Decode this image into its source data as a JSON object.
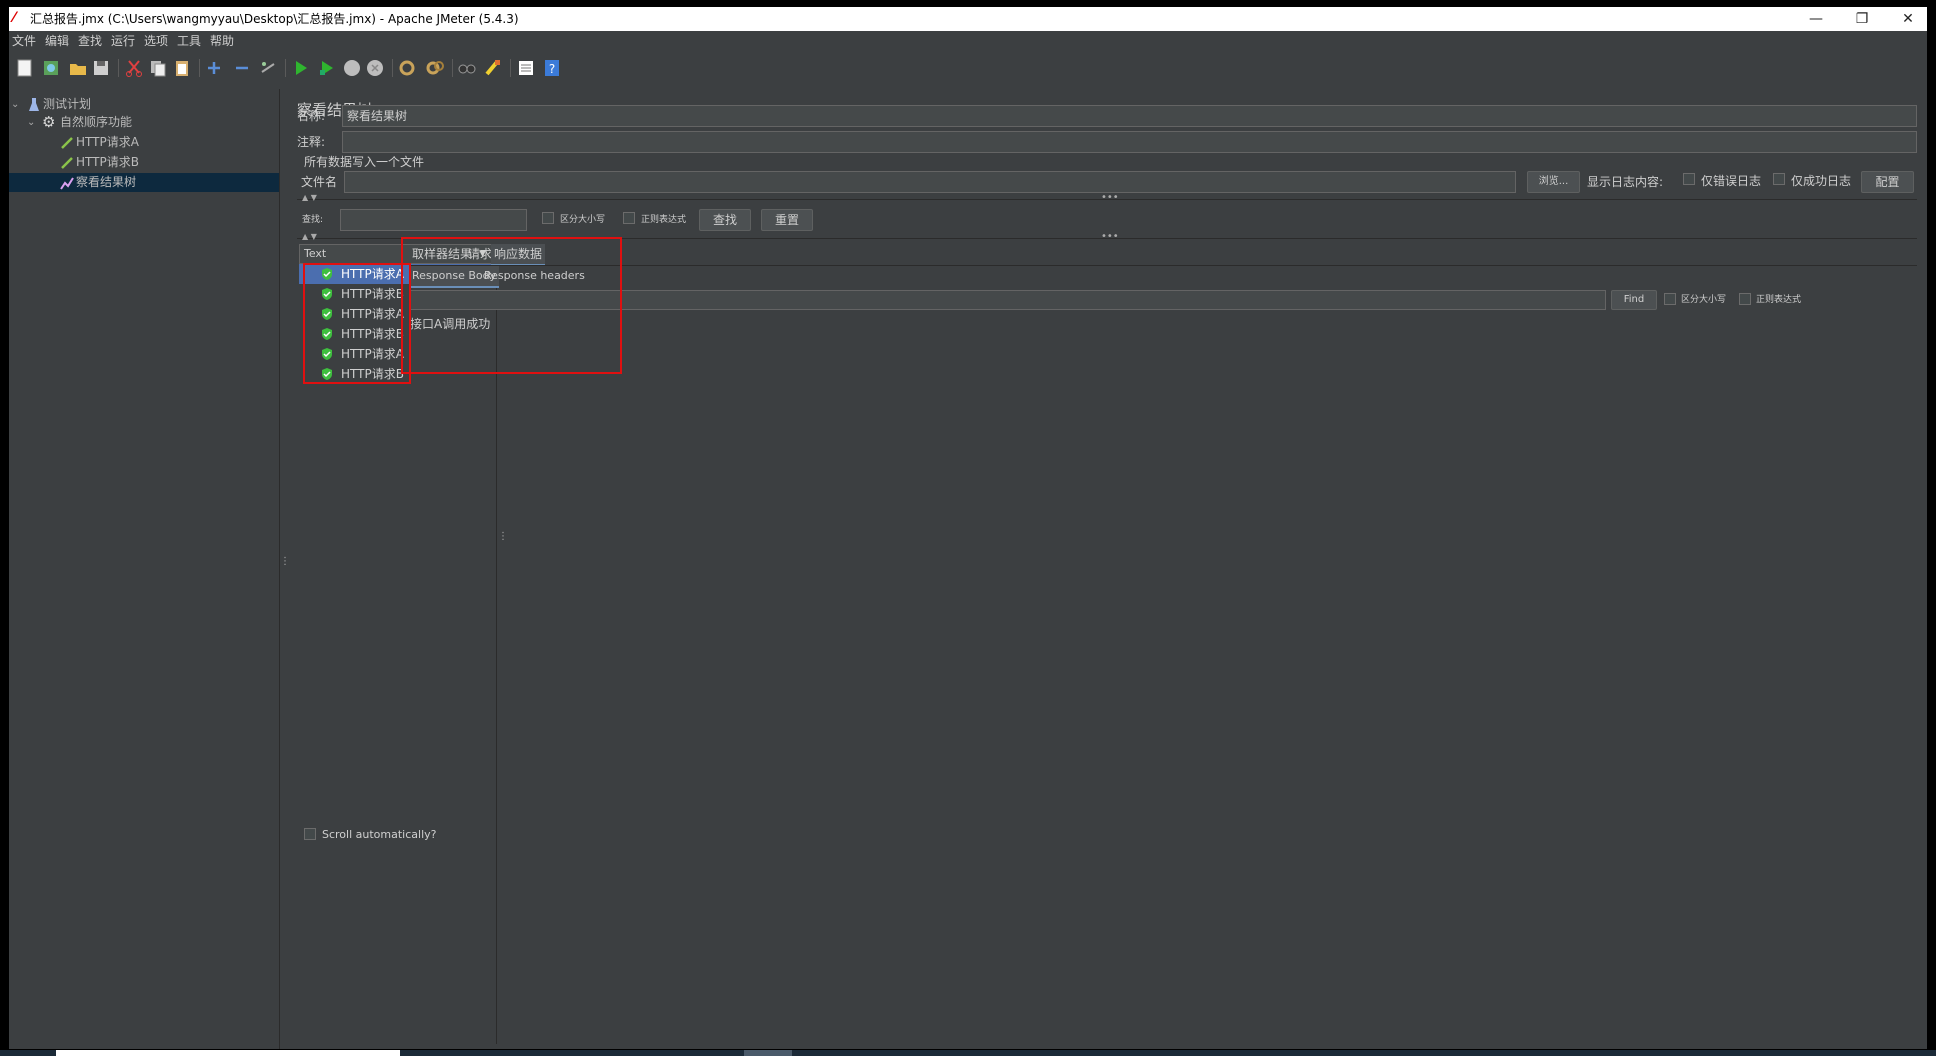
{
  "window": {
    "title": "汇总报告.jmx (C:\\Users\\wangmyyau\\Desktop\\汇总报告.jmx) - Apache JMeter (5.4.3)",
    "controls": {
      "minimize": "—",
      "restore": "❐",
      "close": "✕"
    }
  },
  "menu": [
    "文件",
    "编辑",
    "查找",
    "运行",
    "选项",
    "工具",
    "帮助"
  ],
  "toolbar": {
    "icons": [
      "new-icon",
      "templates-icon",
      "open-icon",
      "save-icon",
      "cut-icon",
      "copy-icon",
      "paste-icon",
      "expand-icon",
      "collapse-icon",
      "toggle-icon",
      "start-icon",
      "start-no-pause-icon",
      "stop-icon",
      "shutdown-icon",
      "clear-icon",
      "clear-all-icon",
      "search-icon",
      "reset-search-icon",
      "function-helper-icon",
      "help-icon"
    ]
  },
  "tree": {
    "items": [
      {
        "label": "测试计划",
        "icon": "test-plan-icon",
        "level": 0,
        "expanded": true
      },
      {
        "label": "自然顺序功能",
        "icon": "gear-icon",
        "level": 1,
        "expanded": true
      },
      {
        "label": "HTTP请求A",
        "icon": "sampler-icon",
        "level": 2
      },
      {
        "label": "HTTP请求B",
        "icon": "sampler-icon",
        "level": 2
      },
      {
        "label": "察看结果树",
        "icon": "listener-icon",
        "level": 2,
        "selected": true
      }
    ]
  },
  "panel": {
    "title": "察看结果树",
    "name_label": "名称:",
    "name_value": "察看结果树",
    "comment_label": "注释:",
    "comment_value": "",
    "file_section_label": "所有数据写入一个文件",
    "filename_label": "文件名",
    "filename_value": "",
    "browse_button": "浏览...",
    "log_display_label": "显示日志内容:",
    "errors_only_label": "仅错误日志",
    "success_only_label": "仅成功日志",
    "configure_button": "配置",
    "search_label": "查找:",
    "search_value": "",
    "case_sensitive_label": "区分大小写",
    "regex_label": "正则表达式",
    "search_button": "查找",
    "reset_button": "重置"
  },
  "results": {
    "renderer": "Text",
    "rows": [
      {
        "label": "HTTP请求A",
        "status": "success",
        "selected": true
      },
      {
        "label": "HTTP请求B",
        "status": "success"
      },
      {
        "label": "HTTP请求A",
        "status": "success"
      },
      {
        "label": "HTTP请求B",
        "status": "success"
      },
      {
        "label": "HTTP请求A",
        "status": "success"
      },
      {
        "label": "HTTP请求B",
        "status": "success"
      }
    ],
    "scroll_auto_label": "Scroll automatically?"
  },
  "detail": {
    "tabs": [
      "取样器结果",
      "请求",
      "响应数据"
    ],
    "active_tab": "响应数据",
    "subtabs": [
      "Response Body",
      "Response headers"
    ],
    "active_subtab": "Response Body",
    "find_value": "",
    "find_button": "Find",
    "case_sensitive_label": "区分大小写",
    "regex_label": "正则表达式",
    "response_body": "接口A调用成功"
  },
  "colors": {
    "background": "#3c3f41",
    "selection": "#4b6eaf",
    "annotation": "#e01010",
    "success_green": "#3fbf3f"
  }
}
